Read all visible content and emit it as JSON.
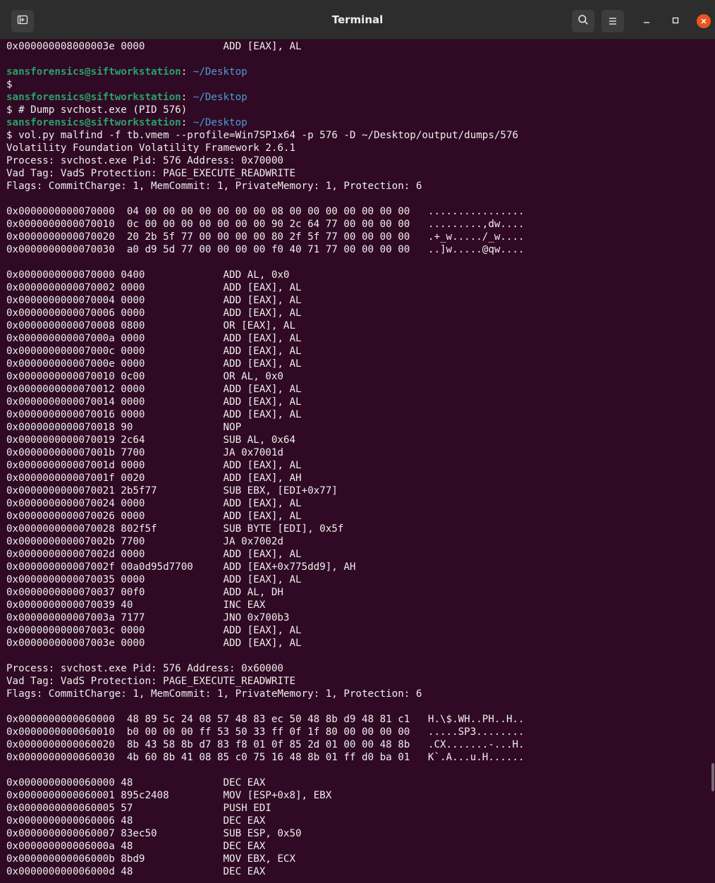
{
  "window": {
    "title": "Terminal",
    "icons": {
      "new_tab": "new-tab-icon",
      "search": "search-icon",
      "menu": "hamburger-menu-icon",
      "minimize": "minimize-icon",
      "maximize": "maximize-icon",
      "close": "close-icon"
    },
    "colors": {
      "background": "#300a24",
      "prompt_user": "#26a269",
      "prompt_path": "#4e9ad6",
      "text": "#eeeeec",
      "close_button": "#e95420"
    }
  },
  "prompt": {
    "user": "sansforensics@siftworkstation",
    "path": "~/Desktop"
  },
  "lines": [
    {
      "t": "0x000000008000003e 0000             ADD [EAX], AL"
    },
    {
      "t": ""
    },
    {
      "prompt": true
    },
    {
      "t": "$"
    },
    {
      "prompt": true
    },
    {
      "t": "$ # Dump svchost.exe (PID 576)"
    },
    {
      "prompt": true
    },
    {
      "t": "$ vol.py malfind -f tb.vmem --profile=Win7SP1x64 -p 576 -D ~/Desktop/output/dumps/576"
    },
    {
      "t": "Volatility Foundation Volatility Framework 2.6.1"
    },
    {
      "t": "Process: svchost.exe Pid: 576 Address: 0x70000"
    },
    {
      "t": "Vad Tag: VadS Protection: PAGE_EXECUTE_READWRITE"
    },
    {
      "t": "Flags: CommitCharge: 1, MemCommit: 1, PrivateMemory: 1, Protection: 6"
    },
    {
      "t": ""
    },
    {
      "t": "0x0000000000070000  04 00 00 00 00 00 00 00 08 00 00 00 00 00 00 00   ................"
    },
    {
      "t": "0x0000000000070010  0c 00 00 00 00 00 00 00 90 2c 64 77 00 00 00 00   .........,dw...."
    },
    {
      "t": "0x0000000000070020  20 2b 5f 77 00 00 00 00 80 2f 5f 77 00 00 00 00   .+_w...../_w...."
    },
    {
      "t": "0x0000000000070030  a0 d9 5d 77 00 00 00 00 f0 40 71 77 00 00 00 00   ..]w.....@qw...."
    },
    {
      "t": ""
    },
    {
      "t": "0x0000000000070000 0400             ADD AL, 0x0"
    },
    {
      "t": "0x0000000000070002 0000             ADD [EAX], AL"
    },
    {
      "t": "0x0000000000070004 0000             ADD [EAX], AL"
    },
    {
      "t": "0x0000000000070006 0000             ADD [EAX], AL"
    },
    {
      "t": "0x0000000000070008 0800             OR [EAX], AL"
    },
    {
      "t": "0x000000000007000a 0000             ADD [EAX], AL"
    },
    {
      "t": "0x000000000007000c 0000             ADD [EAX], AL"
    },
    {
      "t": "0x000000000007000e 0000             ADD [EAX], AL"
    },
    {
      "t": "0x0000000000070010 0c00             OR AL, 0x0"
    },
    {
      "t": "0x0000000000070012 0000             ADD [EAX], AL"
    },
    {
      "t": "0x0000000000070014 0000             ADD [EAX], AL"
    },
    {
      "t": "0x0000000000070016 0000             ADD [EAX], AL"
    },
    {
      "t": "0x0000000000070018 90               NOP"
    },
    {
      "t": "0x0000000000070019 2c64             SUB AL, 0x64"
    },
    {
      "t": "0x000000000007001b 7700             JA 0x7001d"
    },
    {
      "t": "0x000000000007001d 0000             ADD [EAX], AL"
    },
    {
      "t": "0x000000000007001f 0020             ADD [EAX], AH"
    },
    {
      "t": "0x0000000000070021 2b5f77           SUB EBX, [EDI+0x77]"
    },
    {
      "t": "0x0000000000070024 0000             ADD [EAX], AL"
    },
    {
      "t": "0x0000000000070026 0000             ADD [EAX], AL"
    },
    {
      "t": "0x0000000000070028 802f5f           SUB BYTE [EDI], 0x5f"
    },
    {
      "t": "0x000000000007002b 7700             JA 0x7002d"
    },
    {
      "t": "0x000000000007002d 0000             ADD [EAX], AL"
    },
    {
      "t": "0x000000000007002f 00a0d95d7700     ADD [EAX+0x775dd9], AH"
    },
    {
      "t": "0x0000000000070035 0000             ADD [EAX], AL"
    },
    {
      "t": "0x0000000000070037 00f0             ADD AL, DH"
    },
    {
      "t": "0x0000000000070039 40               INC EAX"
    },
    {
      "t": "0x000000000007003a 7177             JNO 0x700b3"
    },
    {
      "t": "0x000000000007003c 0000             ADD [EAX], AL"
    },
    {
      "t": "0x000000000007003e 0000             ADD [EAX], AL"
    },
    {
      "t": ""
    },
    {
      "t": "Process: svchost.exe Pid: 576 Address: 0x60000"
    },
    {
      "t": "Vad Tag: VadS Protection: PAGE_EXECUTE_READWRITE"
    },
    {
      "t": "Flags: CommitCharge: 1, MemCommit: 1, PrivateMemory: 1, Protection: 6"
    },
    {
      "t": ""
    },
    {
      "t": "0x0000000000060000  48 89 5c 24 08 57 48 83 ec 50 48 8b d9 48 81 c1   H.\\$.WH..PH..H.."
    },
    {
      "t": "0x0000000000060010  b0 00 00 00 ff 53 50 33 ff 0f 1f 80 00 00 00 00   .....SP3........"
    },
    {
      "t": "0x0000000000060020  8b 43 58 8b d7 83 f8 01 0f 85 2d 01 00 00 48 8b   .CX.......-...H."
    },
    {
      "t": "0x0000000000060030  4b 60 8b 41 08 85 c0 75 16 48 8b 01 ff d0 ba 01   K`.A...u.H......"
    },
    {
      "t": ""
    },
    {
      "t": "0x0000000000060000 48               DEC EAX"
    },
    {
      "t": "0x0000000000060001 895c2408         MOV [ESP+0x8], EBX"
    },
    {
      "t": "0x0000000000060005 57               PUSH EDI"
    },
    {
      "t": "0x0000000000060006 48               DEC EAX"
    },
    {
      "t": "0x0000000000060007 83ec50           SUB ESP, 0x50"
    },
    {
      "t": "0x000000000006000a 48               DEC EAX"
    },
    {
      "t": "0x000000000006000b 8bd9             MOV EBX, ECX"
    },
    {
      "t": "0x000000000006000d 48               DEC EAX"
    }
  ]
}
